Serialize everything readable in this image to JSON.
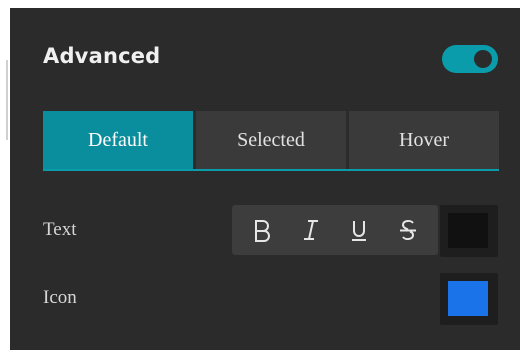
{
  "header": {
    "title": "Advanced",
    "toggle_on": true
  },
  "tabs": [
    {
      "label": "Default",
      "active": true
    },
    {
      "label": "Selected",
      "active": false
    },
    {
      "label": "Hover",
      "active": false
    }
  ],
  "rows": {
    "text": {
      "label": "Text",
      "format_buttons": [
        "bold-icon",
        "italic-icon",
        "underline-icon",
        "strikethrough-icon"
      ],
      "color": "#111111"
    },
    "icon": {
      "label": "Icon",
      "color": "#1a73e8"
    }
  },
  "colors": {
    "accent": "#0a9cab",
    "active_tab": "#0a8d9c",
    "panel_background": "#2b2b2b"
  }
}
